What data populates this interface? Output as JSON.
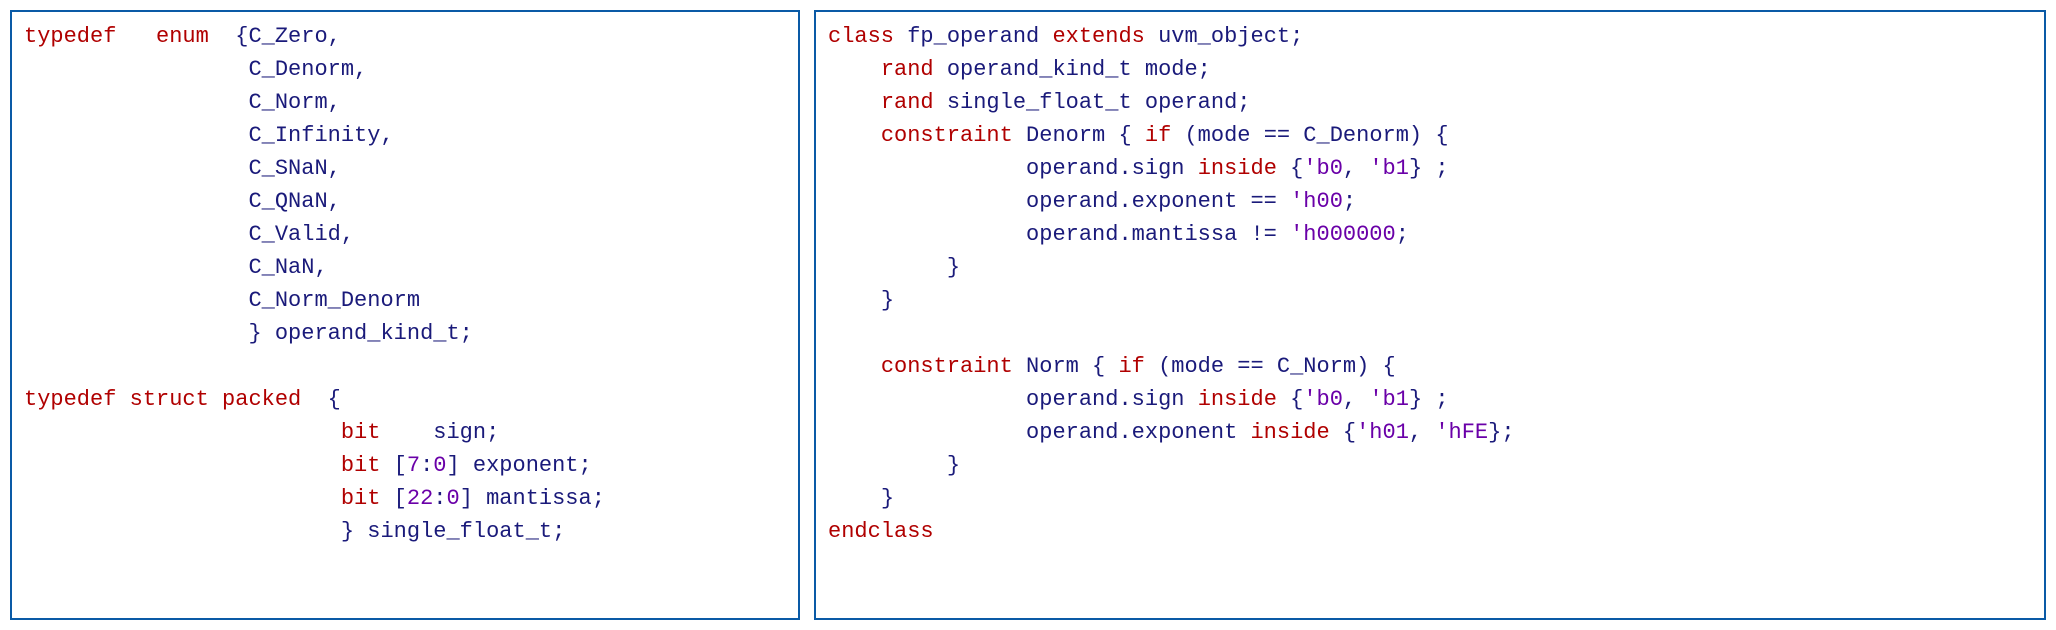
{
  "left": {
    "l1a": "typedef",
    "l1b": "enum",
    "l1c": "{C_Zero,",
    "l2": "C_Denorm,",
    "l3": "C_Norm,",
    "l4": "C_Infinity,",
    "l5": "C_SNaN,",
    "l6": "C_QNaN,",
    "l7": "C_Valid,",
    "l8": "C_NaN,",
    "l9": "C_Norm_Denorm",
    "l10": "} operand_kind_t;",
    "l12a": "typedef",
    "l12b": "struct",
    "l12c": "packed",
    "l12d": "{",
    "l13a": "bit",
    "l13b": "sign;",
    "l14a": "bit",
    "l14b": "[",
    "l14c": "7",
    "l14d": ":",
    "l14e": "0",
    "l14f": "] exponent;",
    "l15a": "bit",
    "l15b": "[",
    "l15c": "22",
    "l15d": ":",
    "l15e": "0",
    "l15f": "] mantissa;",
    "l16": "} single_float_t;"
  },
  "right": {
    "r1a": "class",
    "r1b": "fp_operand",
    "r1c": "extends",
    "r1d": "uvm_object;",
    "r2a": "rand",
    "r2b": "operand_kind_t mode;",
    "r3a": "rand",
    "r3b": "single_float_t operand;",
    "r4a": "constraint",
    "r4b": "Denorm {",
    "r4c": "if",
    "r4d": "(mode == C_Denorm) {",
    "r5a": "operand.sign",
    "r5b": "inside",
    "r5c": "{",
    "r5d": "'b0",
    "r5e": ",",
    "r5f": "'b1",
    "r5g": "} ;",
    "r6a": "operand.exponent ==",
    "r6b": "'h00",
    "r6c": ";",
    "r7a": "operand.mantissa !=",
    "r7b": "'h000000",
    "r7c": ";",
    "r8": "}",
    "r9": "}",
    "r11a": "constraint",
    "r11b": "Norm {",
    "r11c": "if",
    "r11d": "(mode == C_Norm) {",
    "r12a": "operand.sign",
    "r12b": "inside",
    "r12c": "{",
    "r12d": "'b0",
    "r12e": ",",
    "r12f": "'b1",
    "r12g": "} ;",
    "r13a": "operand.exponent",
    "r13b": "inside",
    "r13c": "{",
    "r13d": "'h01",
    "r13e": ",",
    "r13f": "'hFE",
    "r13g": "};",
    "r14": "}",
    "r15": "}",
    "r16": "endclass"
  }
}
